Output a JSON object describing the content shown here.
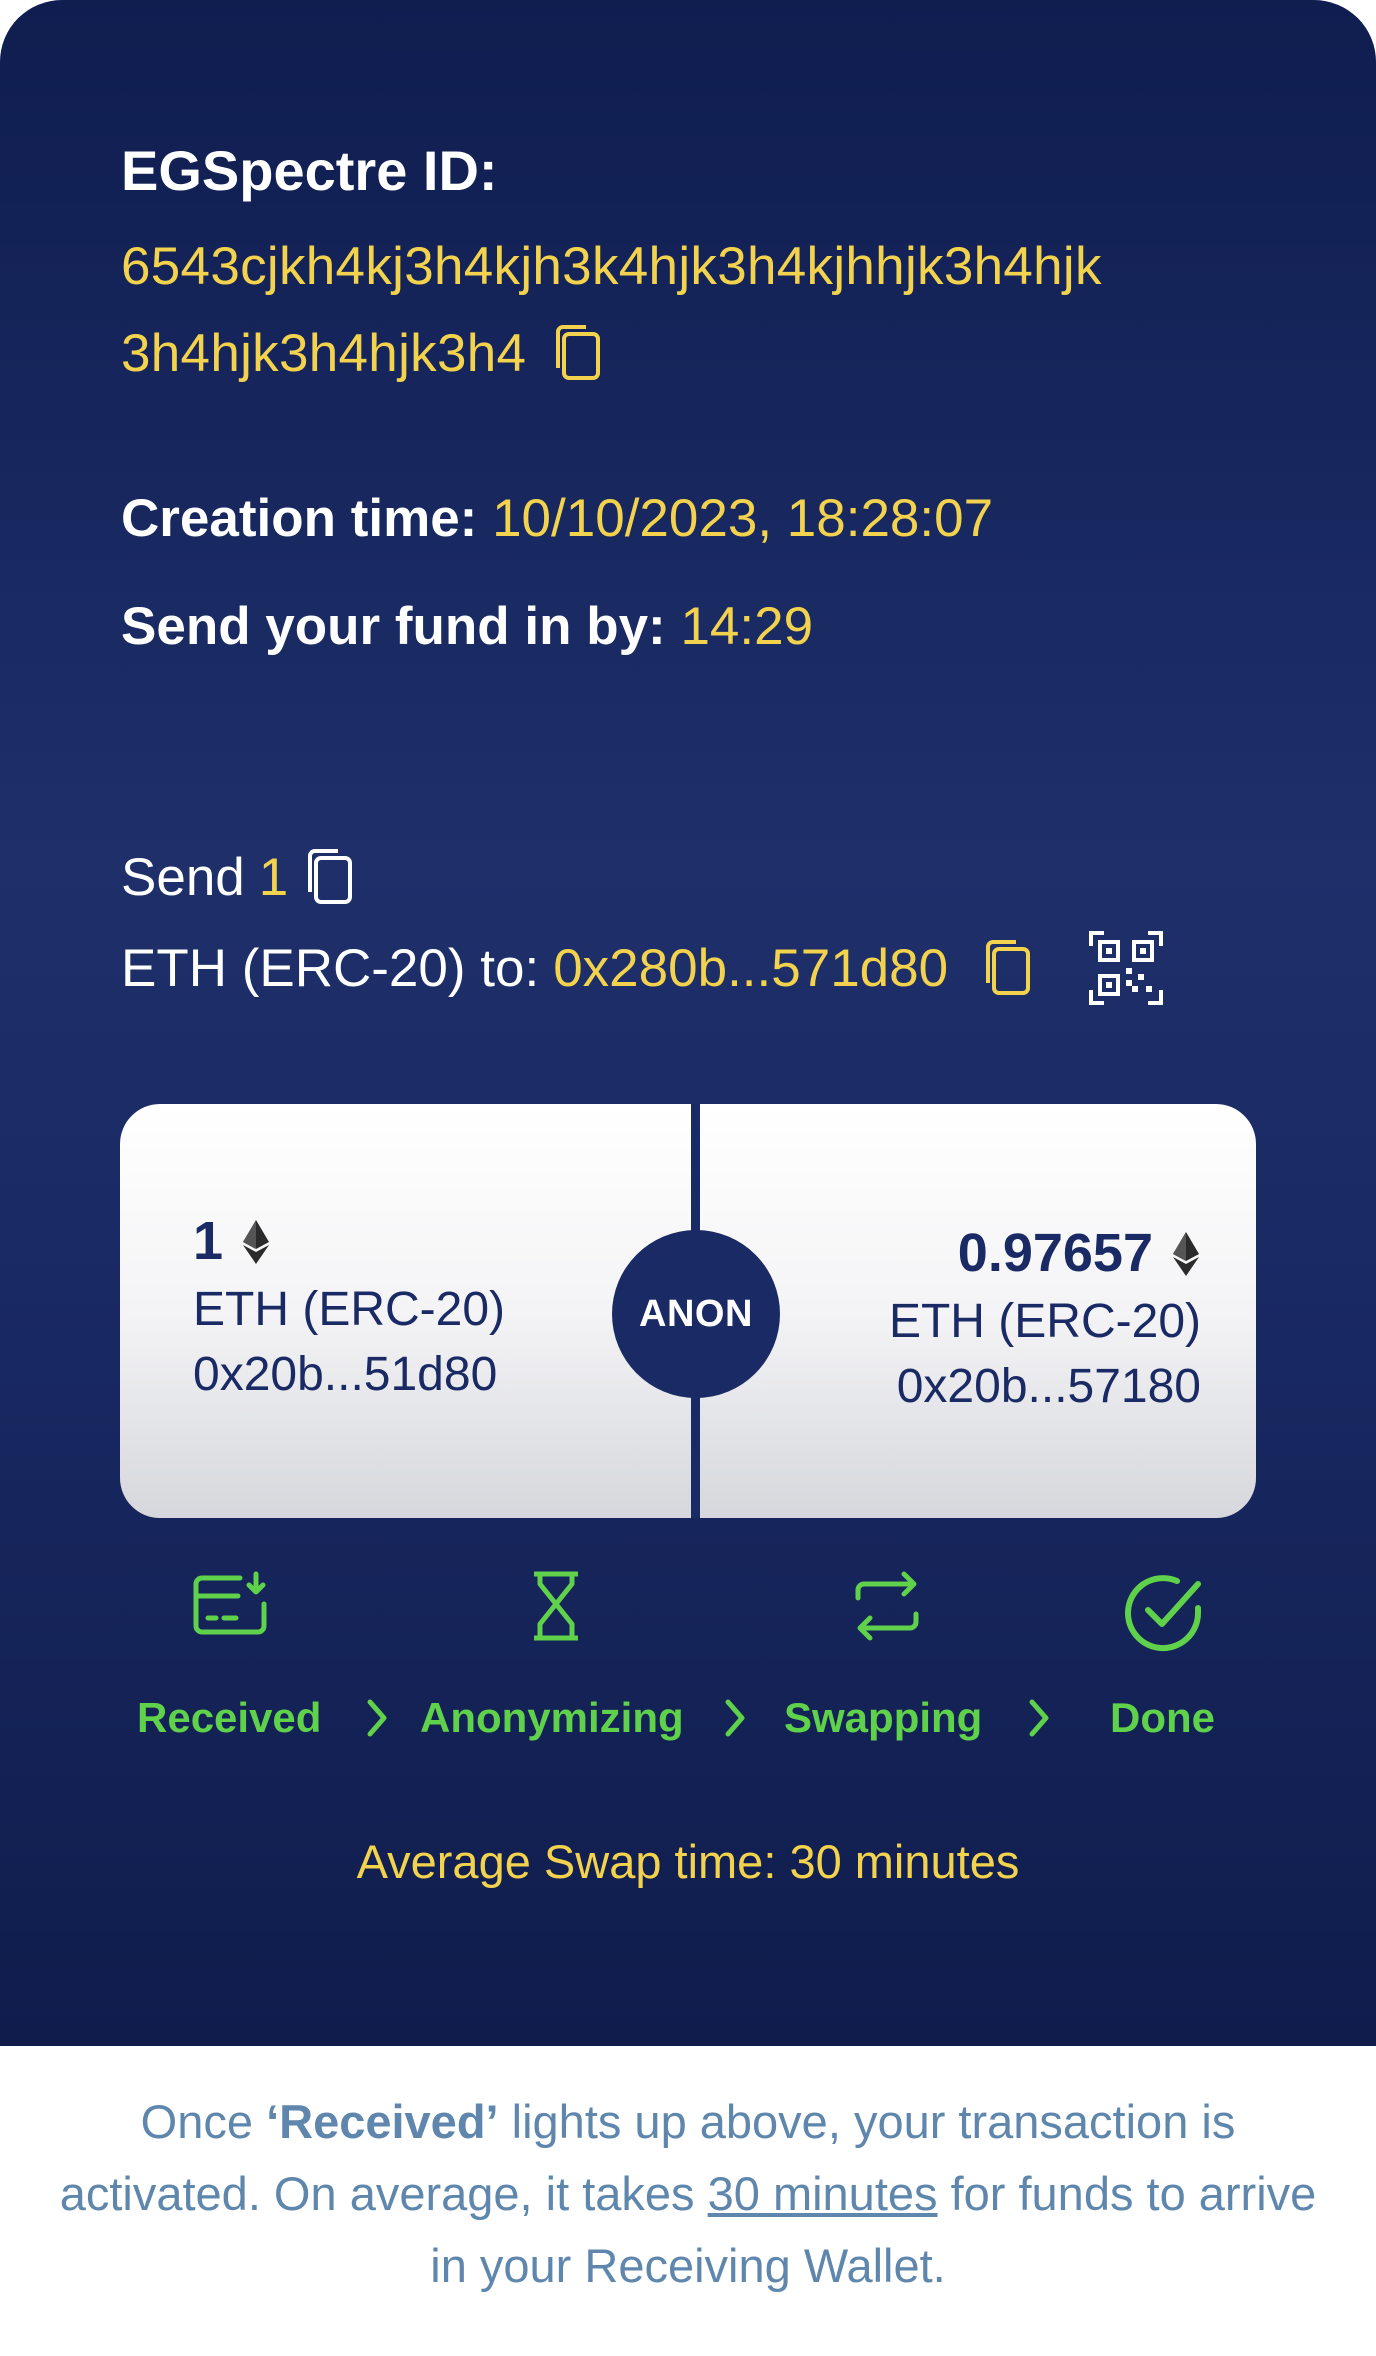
{
  "id": {
    "label": "EGSpectre ID:",
    "line1": "6543cjkh4kj3h4kjh3k4hjk3h4kjhhjk3h4hjk",
    "line2": "3h4hjk3h4hjk3h4"
  },
  "creation": {
    "label": "Creation time:",
    "value": "10/10/2023, 18:28:07"
  },
  "send_by": {
    "label": "Send your fund in by:",
    "value": "14:29"
  },
  "send": {
    "prefix": "Send",
    "amount": "1",
    "asset_to": "ETH (ERC-20) to:",
    "address": "0x280b...571d80"
  },
  "swap": {
    "left": {
      "amount": "1",
      "asset": "ETH (ERC-20)",
      "address": "0x20b...51d80"
    },
    "center_label": "ANON",
    "right": {
      "amount": "0.97657",
      "asset": "ETH (ERC-20)",
      "address": "0x20b...57180"
    }
  },
  "steps": [
    {
      "label": "Received",
      "icon": "card-download-icon"
    },
    {
      "label": "Anonymizing",
      "icon": "hourglass-icon"
    },
    {
      "label": "Swapping",
      "icon": "swap-arrows-icon"
    },
    {
      "label": "Done",
      "icon": "check-circle-icon"
    }
  ],
  "avg_swap": "Average Swap time: 30 minutes",
  "note": {
    "p1": "Once ",
    "bold": "‘Received’",
    "p2": " lights up above, your transaction is activated. On average, it takes ",
    "link": "30 minutes",
    "p3": " for funds to arrive in your Receiving Wallet."
  },
  "colors": {
    "panel_bg": "#1a2a64",
    "accent_gold": "#f3d34d",
    "step_green": "#5fd14a",
    "note_blue": "#5f87ad"
  }
}
